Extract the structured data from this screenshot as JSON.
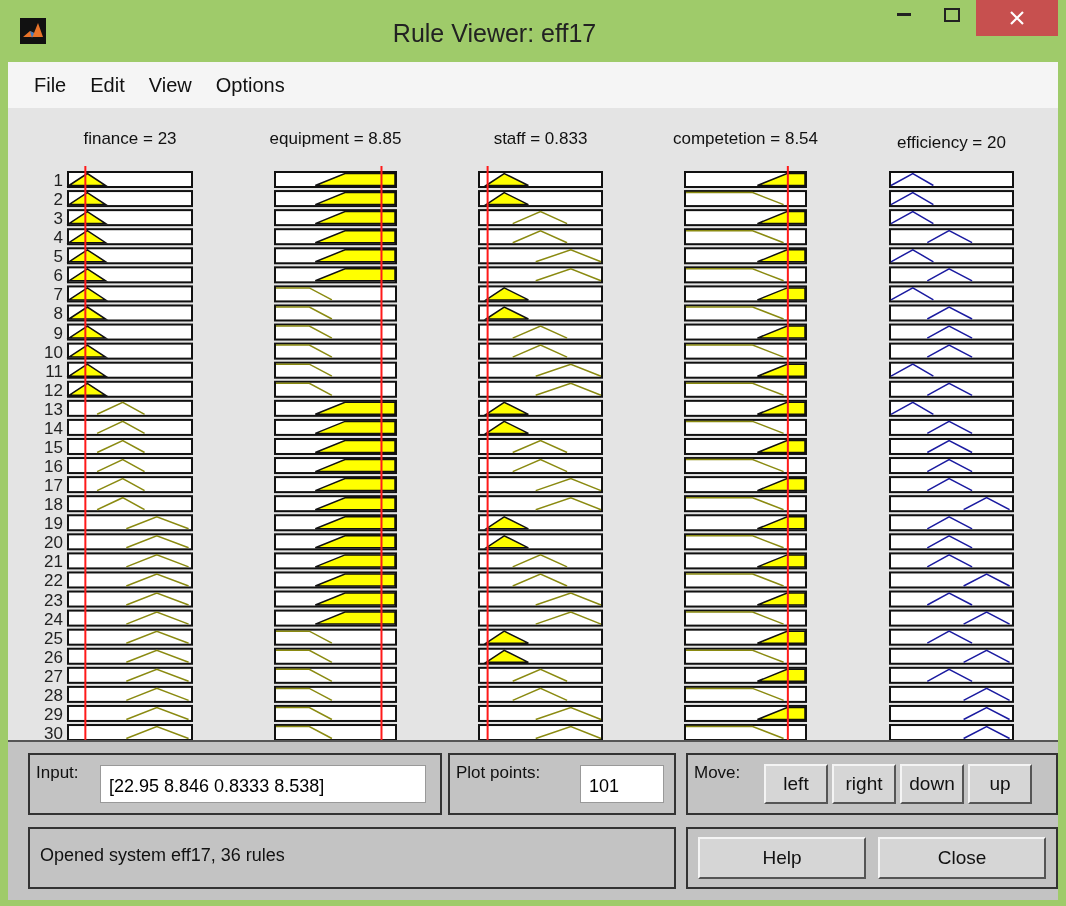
{
  "window": {
    "title": "Rule Viewer: eff17"
  },
  "menu": [
    "File",
    "Edit",
    "View",
    "Options"
  ],
  "columns": [
    {
      "kind": "input",
      "label": "finance = 23"
    },
    {
      "kind": "input",
      "label": "equipment = 8.85"
    },
    {
      "kind": "input",
      "label": "staff = 0.833"
    },
    {
      "kind": "input",
      "label": "competetion = 8.54"
    },
    {
      "kind": "output",
      "label": "efficiency = 20"
    }
  ],
  "rules": [
    {
      "number": "1",
      "cells": [
        {
          "kind": "low",
          "fired": true
        },
        {
          "kind": "high",
          "fired": true
        },
        {
          "kind": "low",
          "fired": true
        },
        {
          "kind": "high",
          "fired": true
        },
        {
          "kind": "low"
        }
      ]
    },
    {
      "number": "2",
      "cells": [
        {
          "kind": "low",
          "fired": true
        },
        {
          "kind": "high",
          "fired": true
        },
        {
          "kind": "low",
          "fired": true
        },
        {
          "kind": "low",
          "fired": false
        },
        {
          "kind": "low"
        }
      ]
    },
    {
      "number": "3",
      "cells": [
        {
          "kind": "low",
          "fired": true
        },
        {
          "kind": "high",
          "fired": true
        },
        {
          "kind": "mid",
          "fired": false
        },
        {
          "kind": "high",
          "fired": true
        },
        {
          "kind": "low"
        }
      ]
    },
    {
      "number": "4",
      "cells": [
        {
          "kind": "low",
          "fired": true
        },
        {
          "kind": "high",
          "fired": true
        },
        {
          "kind": "mid",
          "fired": false
        },
        {
          "kind": "low",
          "fired": false
        },
        {
          "kind": "mid"
        }
      ]
    },
    {
      "number": "5",
      "cells": [
        {
          "kind": "low",
          "fired": true
        },
        {
          "kind": "high",
          "fired": true
        },
        {
          "kind": "high",
          "fired": false
        },
        {
          "kind": "high",
          "fired": true
        },
        {
          "kind": "low"
        }
      ]
    },
    {
      "number": "6",
      "cells": [
        {
          "kind": "low",
          "fired": true
        },
        {
          "kind": "high",
          "fired": true
        },
        {
          "kind": "high",
          "fired": false
        },
        {
          "kind": "low",
          "fired": false
        },
        {
          "kind": "mid"
        }
      ]
    },
    {
      "number": "7",
      "cells": [
        {
          "kind": "low",
          "fired": true
        },
        {
          "kind": "low",
          "fired": false
        },
        {
          "kind": "low",
          "fired": true
        },
        {
          "kind": "high",
          "fired": true
        },
        {
          "kind": "low"
        }
      ]
    },
    {
      "number": "8",
      "cells": [
        {
          "kind": "low",
          "fired": true
        },
        {
          "kind": "low",
          "fired": false
        },
        {
          "kind": "low",
          "fired": true
        },
        {
          "kind": "low",
          "fired": false
        },
        {
          "kind": "mid"
        }
      ]
    },
    {
      "number": "9",
      "cells": [
        {
          "kind": "low",
          "fired": true
        },
        {
          "kind": "low",
          "fired": false
        },
        {
          "kind": "mid",
          "fired": false
        },
        {
          "kind": "high",
          "fired": true
        },
        {
          "kind": "mid"
        }
      ]
    },
    {
      "number": "10",
      "cells": [
        {
          "kind": "low",
          "fired": true
        },
        {
          "kind": "low",
          "fired": false
        },
        {
          "kind": "mid",
          "fired": false
        },
        {
          "kind": "low",
          "fired": false
        },
        {
          "kind": "mid"
        }
      ]
    },
    {
      "number": "11",
      "cells": [
        {
          "kind": "low",
          "fired": true
        },
        {
          "kind": "low",
          "fired": false
        },
        {
          "kind": "high",
          "fired": false
        },
        {
          "kind": "high",
          "fired": true
        },
        {
          "kind": "low"
        }
      ]
    },
    {
      "number": "12",
      "cells": [
        {
          "kind": "low",
          "fired": true
        },
        {
          "kind": "low",
          "fired": false
        },
        {
          "kind": "high",
          "fired": false
        },
        {
          "kind": "low",
          "fired": false
        },
        {
          "kind": "mid"
        }
      ]
    },
    {
      "number": "13",
      "cells": [
        {
          "kind": "mid",
          "fired": false
        },
        {
          "kind": "high",
          "fired": true
        },
        {
          "kind": "low",
          "fired": true
        },
        {
          "kind": "high",
          "fired": true
        },
        {
          "kind": "low"
        }
      ]
    },
    {
      "number": "14",
      "cells": [
        {
          "kind": "mid",
          "fired": false
        },
        {
          "kind": "high",
          "fired": true
        },
        {
          "kind": "low",
          "fired": true
        },
        {
          "kind": "low",
          "fired": false
        },
        {
          "kind": "mid"
        }
      ]
    },
    {
      "number": "15",
      "cells": [
        {
          "kind": "mid",
          "fired": false
        },
        {
          "kind": "high",
          "fired": true
        },
        {
          "kind": "mid",
          "fired": false
        },
        {
          "kind": "high",
          "fired": true
        },
        {
          "kind": "mid"
        }
      ]
    },
    {
      "number": "16",
      "cells": [
        {
          "kind": "mid",
          "fired": false
        },
        {
          "kind": "high",
          "fired": true
        },
        {
          "kind": "mid",
          "fired": false
        },
        {
          "kind": "low",
          "fired": false
        },
        {
          "kind": "mid"
        }
      ]
    },
    {
      "number": "17",
      "cells": [
        {
          "kind": "mid",
          "fired": false
        },
        {
          "kind": "high",
          "fired": true
        },
        {
          "kind": "high",
          "fired": false
        },
        {
          "kind": "high",
          "fired": true
        },
        {
          "kind": "mid"
        }
      ]
    },
    {
      "number": "18",
      "cells": [
        {
          "kind": "mid",
          "fired": false
        },
        {
          "kind": "high",
          "fired": true
        },
        {
          "kind": "high",
          "fired": false
        },
        {
          "kind": "low",
          "fired": false
        },
        {
          "kind": "high"
        }
      ]
    },
    {
      "number": "19",
      "cells": [
        {
          "kind": "high",
          "fired": false
        },
        {
          "kind": "high",
          "fired": true
        },
        {
          "kind": "low",
          "fired": true
        },
        {
          "kind": "high",
          "fired": true
        },
        {
          "kind": "mid"
        }
      ]
    },
    {
      "number": "20",
      "cells": [
        {
          "kind": "high",
          "fired": false
        },
        {
          "kind": "high",
          "fired": true
        },
        {
          "kind": "low",
          "fired": true
        },
        {
          "kind": "low",
          "fired": false
        },
        {
          "kind": "mid"
        }
      ]
    },
    {
      "number": "21",
      "cells": [
        {
          "kind": "high",
          "fired": false
        },
        {
          "kind": "high",
          "fired": true
        },
        {
          "kind": "mid",
          "fired": false
        },
        {
          "kind": "high",
          "fired": true
        },
        {
          "kind": "mid"
        }
      ]
    },
    {
      "number": "22",
      "cells": [
        {
          "kind": "high",
          "fired": false
        },
        {
          "kind": "high",
          "fired": true
        },
        {
          "kind": "mid",
          "fired": false
        },
        {
          "kind": "low",
          "fired": false
        },
        {
          "kind": "high"
        }
      ]
    },
    {
      "number": "23",
      "cells": [
        {
          "kind": "high",
          "fired": false
        },
        {
          "kind": "high",
          "fired": true
        },
        {
          "kind": "high",
          "fired": false
        },
        {
          "kind": "high",
          "fired": true
        },
        {
          "kind": "mid"
        }
      ]
    },
    {
      "number": "24",
      "cells": [
        {
          "kind": "high",
          "fired": false
        },
        {
          "kind": "high",
          "fired": true
        },
        {
          "kind": "high",
          "fired": false
        },
        {
          "kind": "low",
          "fired": false
        },
        {
          "kind": "high"
        }
      ]
    },
    {
      "number": "25",
      "cells": [
        {
          "kind": "high",
          "fired": false
        },
        {
          "kind": "low",
          "fired": false
        },
        {
          "kind": "low",
          "fired": true
        },
        {
          "kind": "high",
          "fired": true
        },
        {
          "kind": "mid"
        }
      ]
    },
    {
      "number": "26",
      "cells": [
        {
          "kind": "high",
          "fired": false
        },
        {
          "kind": "low",
          "fired": false
        },
        {
          "kind": "low",
          "fired": true
        },
        {
          "kind": "low",
          "fired": false
        },
        {
          "kind": "high"
        }
      ]
    },
    {
      "number": "27",
      "cells": [
        {
          "kind": "high",
          "fired": false
        },
        {
          "kind": "low",
          "fired": false
        },
        {
          "kind": "mid",
          "fired": false
        },
        {
          "kind": "high",
          "fired": true
        },
        {
          "kind": "mid"
        }
      ]
    },
    {
      "number": "28",
      "cells": [
        {
          "kind": "high",
          "fired": false
        },
        {
          "kind": "low",
          "fired": false
        },
        {
          "kind": "mid",
          "fired": false
        },
        {
          "kind": "low",
          "fired": false
        },
        {
          "kind": "high"
        }
      ]
    },
    {
      "number": "29",
      "cells": [
        {
          "kind": "high",
          "fired": false
        },
        {
          "kind": "low",
          "fired": false
        },
        {
          "kind": "high",
          "fired": false
        },
        {
          "kind": "high",
          "fired": true
        },
        {
          "kind": "high"
        }
      ]
    },
    {
      "number": "30",
      "cells": [
        {
          "kind": "high",
          "fired": false
        },
        {
          "kind": "low",
          "fired": false
        },
        {
          "kind": "high",
          "fired": false
        },
        {
          "kind": "low",
          "fired": false
        },
        {
          "kind": "high"
        }
      ]
    }
  ],
  "input": {
    "label": "Input:",
    "value": "[22.95 8.846 0.8333 8.538]"
  },
  "plot_points": {
    "label": "Plot points:",
    "value": "101"
  },
  "move": {
    "label": "Move:",
    "buttons": [
      "left",
      "right",
      "down",
      "up"
    ]
  },
  "status": "Opened system eff17, 36 rules",
  "buttons": [
    "Help",
    "Close"
  ]
}
